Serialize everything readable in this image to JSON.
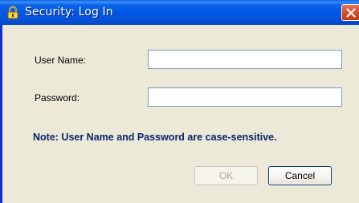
{
  "window": {
    "title": "Security: Log In",
    "title_icon": "padlock-icon",
    "close_icon": "close-icon"
  },
  "form": {
    "username_label": "User Name:",
    "username_value": "",
    "password_label": "Password:",
    "password_value": "",
    "note": "Note: User Name and Password are case-sensitive."
  },
  "buttons": {
    "ok_label": "OK",
    "ok_enabled": false,
    "cancel_label": "Cancel"
  },
  "colors": {
    "titlebar": "#0055e5",
    "dialog_background": "#ece9d8",
    "note_text": "#0a246a",
    "close_button": "#d9532f",
    "input_border": "#7f9db9"
  }
}
